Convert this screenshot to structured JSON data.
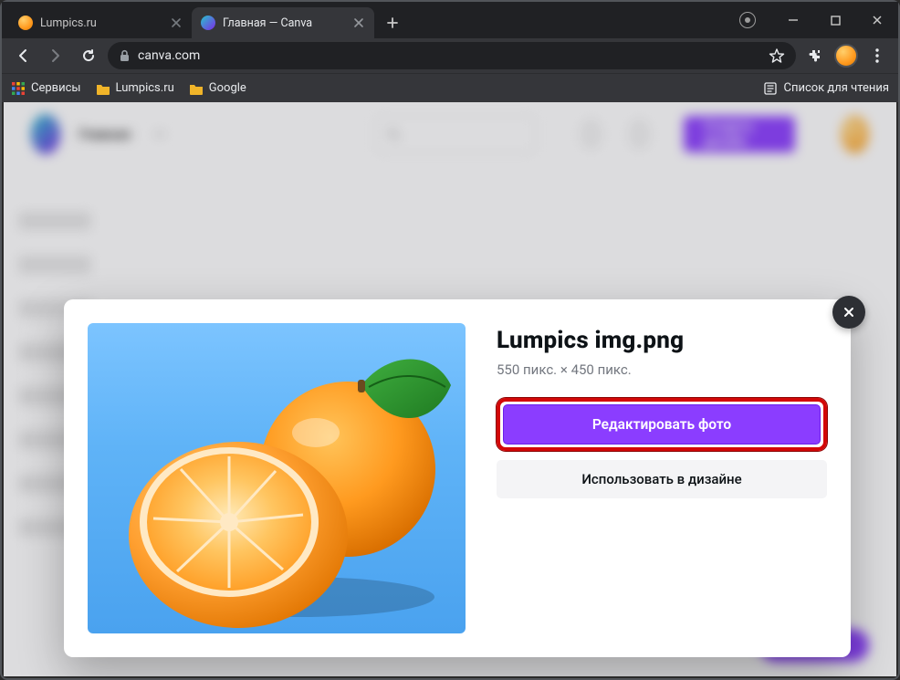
{
  "browser": {
    "tabs": [
      {
        "title": "Lumpics.ru",
        "favicon_color": "#ff9a1f",
        "active": false
      },
      {
        "title": "Главная — Canva",
        "favicon_color": "#27c4cc",
        "active": true
      }
    ],
    "url": "canva.com",
    "star_icon": "star-icon",
    "extension_icon": "puzzle-icon",
    "bookmarks": {
      "apps": "Сервисы",
      "items": [
        {
          "label": "Lumpics.ru"
        },
        {
          "label": "Google"
        }
      ],
      "reading_list": "Список для чтения"
    }
  },
  "canva": {
    "home_label": "Главная",
    "search_placeholder": "",
    "cta_label": "Создать дизайн"
  },
  "modal": {
    "title": "Lumpics img.png",
    "dimensions": "550 пикс. × 450 пикс.",
    "primary_label": "Редактировать фото",
    "secondary_label": "Использовать в дизайне",
    "highlight_color": "#d30808",
    "primary_color": "#8b3dff"
  }
}
